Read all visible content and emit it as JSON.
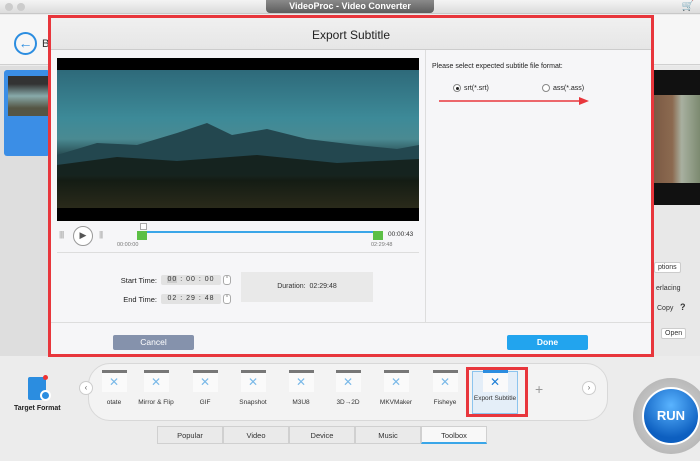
{
  "window": {
    "title": "VideoProc - Video Converter"
  },
  "app": {
    "back_label": "B",
    "right_buttons": [
      "ptions",
      "erlacing",
      "Copy",
      "?",
      "Open"
    ]
  },
  "dialog": {
    "title": "Export Subtitle",
    "timeline": {
      "start": "00:00:00",
      "end": "02:29:48",
      "current": "00:00:43"
    },
    "start_time": {
      "label": "Start Time:",
      "hh": "00",
      "mm": "00",
      "ss": "00"
    },
    "end_time": {
      "label": "End Time:",
      "hh": "02",
      "mm": "29",
      "ss": "48"
    },
    "duration": {
      "label": "Duration:",
      "value": "02:29:48"
    },
    "format_prompt": "Please select expected subtitle file format:",
    "formats": [
      {
        "label": "srt(*.srt)",
        "selected": true
      },
      {
        "label": "ass(*.ass)",
        "selected": false
      }
    ],
    "cancel": "Cancel",
    "done": "Done"
  },
  "toolbar": {
    "target_format": "Target Format",
    "tools": [
      "otate",
      "Mirror & Flip",
      "GIF",
      "Snapshot",
      "M3U8",
      "3D→2D",
      "MKVMaker",
      "Fisheye",
      "Export Subtitle"
    ],
    "tabs": [
      "Popular",
      "Video",
      "Device",
      "Music",
      "Toolbox"
    ],
    "active_tab": "Toolbox",
    "run": "RUN"
  },
  "colors": {
    "accent": "#22a4ee",
    "highlight": "#e8363c",
    "run": "#0d5fc0"
  }
}
